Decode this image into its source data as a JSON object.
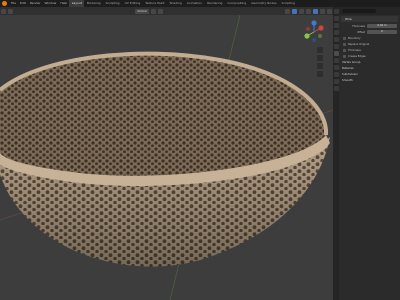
{
  "menu": [
    "File",
    "Edit",
    "Render",
    "Window",
    "Help"
  ],
  "workspaces": [
    "Layout",
    "Modeling",
    "Sculpting",
    "UV Editing",
    "Texture Paint",
    "Shading",
    "Animation",
    "Rendering",
    "Compositing",
    "Geometry Nodes",
    "Scripting"
  ],
  "header": {
    "view_mode": "Global"
  },
  "properties": {
    "modifier_name": "Wire",
    "rows": [
      {
        "label": "Thickness",
        "value": "0.02 m"
      },
      {
        "label": "Offset",
        "value": "0"
      },
      {
        "label": "Boundary",
        "value": ""
      },
      {
        "label": "Replace Original",
        "value": ""
      },
      {
        "label": "Thickness",
        "value": ""
      },
      {
        "label": "Crease Edges",
        "value": ""
      }
    ],
    "sections": [
      "Vertex Group",
      "Material",
      "Subdivision",
      "Smooth"
    ]
  },
  "colors": {
    "accent": "#4772b3",
    "blender_orange": "#e87d0d",
    "bowl": "#b19c82"
  }
}
